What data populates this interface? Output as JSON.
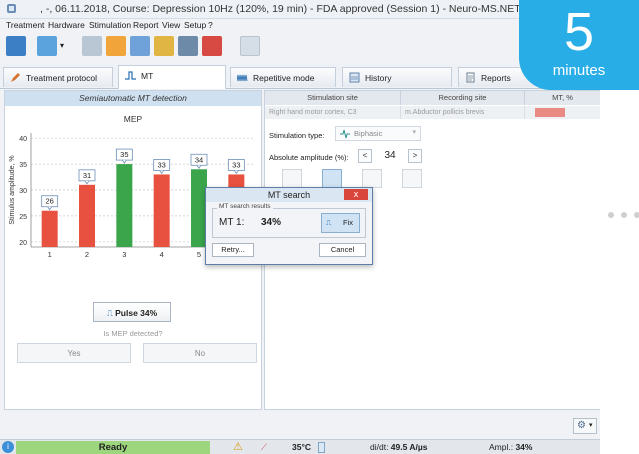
{
  "window": {
    "title": ", -, 06.11.2018, Course: Depression 10Hz (120%, 19 min) - FDA approved (Session 1) - Neuro-MS.NET"
  },
  "menu": [
    "Treatment",
    "Hardware",
    "Stimulation",
    "Report",
    "View",
    "Setup",
    "?"
  ],
  "tabs": [
    {
      "label": "Treatment protocol"
    },
    {
      "label": "MT"
    },
    {
      "label": "Repetitive mode"
    },
    {
      "label": "History"
    },
    {
      "label": "Reports"
    }
  ],
  "left_panel": {
    "header": "Semiautomatic MT detection",
    "pulse_button": "Pulse 34%",
    "question": "Is MEP detected?",
    "yes_label": "Yes",
    "no_label": "No"
  },
  "chart_data": {
    "type": "bar",
    "title": "MEP",
    "ylabel": "Stimulus amplitude, %",
    "categories": [
      "1",
      "2",
      "3",
      "4",
      "5",
      "6"
    ],
    "values": [
      26,
      31,
      35,
      33,
      34,
      33
    ],
    "data_labels": [
      "26",
      "31",
      "35",
      "33",
      "34",
      "33"
    ],
    "bar_colors": [
      "#e8503f",
      "#e8503f",
      "#3aa54a",
      "#e8503f",
      "#3aa54a",
      "#e8503f"
    ],
    "yticks": [
      20,
      25,
      30,
      35,
      40
    ],
    "ylim": [
      19,
      41
    ],
    "grid": true
  },
  "right_panel": {
    "col_stim_site": "Stimulation site",
    "col_rec_site": "Recording site",
    "col_mt": "MT, %",
    "row_stim_site": "Right hand motor cortex, C3",
    "row_rec_site": "m.Abductor pollicis brevis",
    "stim_type_label": "Stimulation type:",
    "stim_type_value": "Biphasic",
    "amp_label": "Absolute amplitude (%):",
    "amp_value": "34",
    "amp_dec": "<",
    "amp_inc": ">"
  },
  "dialog": {
    "title": "MT search",
    "close": "x",
    "group_label": "MT search results",
    "mt_label": "MT 1:",
    "mt_value": "34%",
    "fix_label": "Fix",
    "retry_label": "Retry...",
    "cancel_label": "Cancel"
  },
  "status": {
    "ready": "Ready",
    "temp": "35°C",
    "didt_prefix": "di/dt: ",
    "didt_value": "49.5 A/µs",
    "ampl_prefix": "Ampl.: ",
    "ampl_value": "34%"
  },
  "badge": {
    "number": "5",
    "unit": "minutes"
  },
  "colors": {
    "accent": "#29ade7",
    "ready": "#9ed67e",
    "bar_red": "#e8503f",
    "bar_green": "#3aa54a"
  }
}
